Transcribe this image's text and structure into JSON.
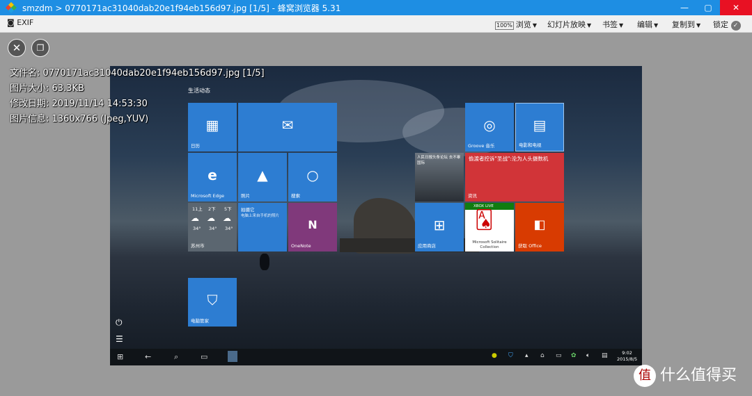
{
  "window": {
    "title": "smzdm  >  0770171ac31040dab20e1f94eb156d97.jpg [1/5]  -  蜂窝浏览器 5.31",
    "minimize": "—",
    "maximize": "▢",
    "close": "✕"
  },
  "toolbar": {
    "exif": "EXIF",
    "zoom": "100%",
    "browse": "浏览",
    "slideshow": "幻灯片放映",
    "bookmark": "书签",
    "edit": "编辑",
    "copyto": "复制到",
    "lock": "锁定"
  },
  "info": {
    "filename": "文件名: 0770171ac31040dab20e1f94eb156d97.jpg [1/5]",
    "size": "图片大小: 63.3KB",
    "modified": "修改日期: 2019/11/14 14:53:30",
    "imageinfo": "图片信息: 1360x766 (Jpeg,YUV)"
  },
  "start": {
    "section": "生活动态",
    "tiles": {
      "calendar": "日历",
      "edge": "Microsoft Edge",
      "photos": "照片",
      "search": "搜索",
      "weather_city": "苏州市",
      "weather_days": [
        "11上",
        "2下",
        "5下"
      ],
      "weather_temps": [
        "34°",
        "34°",
        "34°"
      ],
      "phone_title": "拍摄它",
      "phone_sub": "电脑上来自手机的照片",
      "onenote": "OneNote",
      "groove": "Groove 音乐",
      "movies": "电影和电视",
      "news_photo": "人民日报头条论坛 去不辜国际",
      "news": "资讯",
      "news_headline": "偷渡者控诉\"圣战\":沦为人头摄数机",
      "store": "应用商店",
      "xbox": "XBOX LIVE",
      "solitaire": "Microsoft Solitaire Collection",
      "office": "获取 Office",
      "guard": "电脑管家"
    },
    "clock_time": "9:02",
    "clock_date": "2015/8/5"
  },
  "watermark": "什么值得买",
  "colors": {
    "titlebar": "#1e8ee3",
    "tile_blue": "#2d7dd2",
    "tile_red": "#d13438",
    "tile_purple": "#80397b",
    "tile_orange": "#d83b01"
  }
}
